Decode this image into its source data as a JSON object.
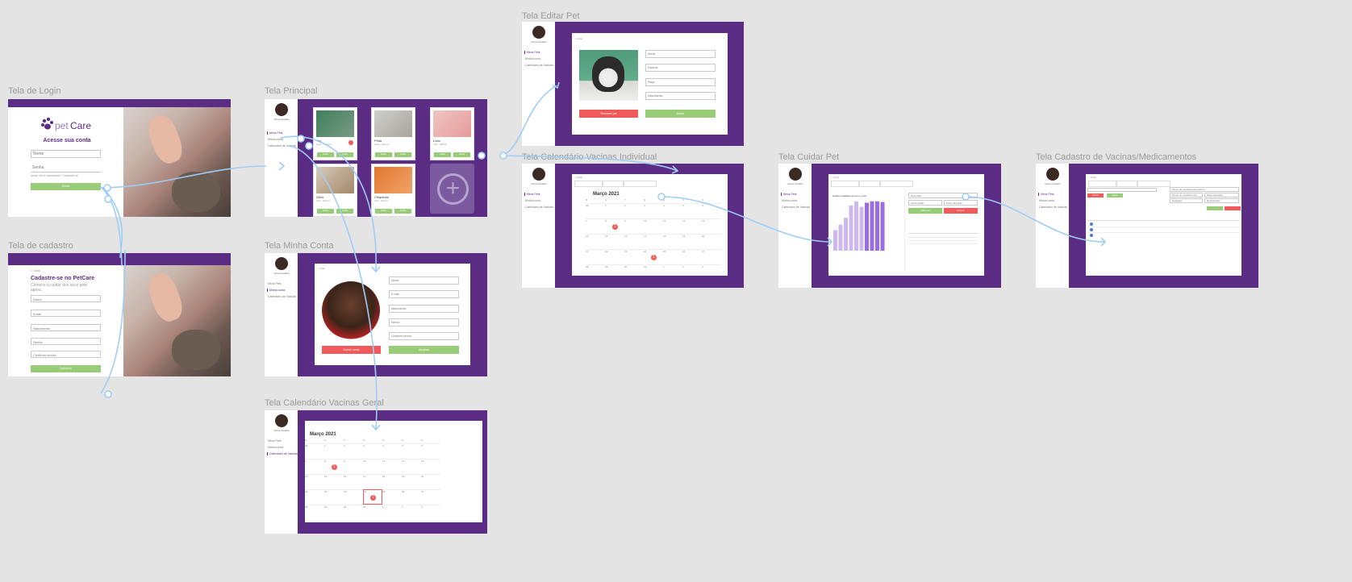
{
  "frames": {
    "login": {
      "title": "Tela de Login",
      "brand_pet": "pet",
      "brand_care": "Care",
      "heading": "Acesse sua conta",
      "name_placeholder": "Nome",
      "password_placeholder": "Senha",
      "forgot": "Ainda não é cadastrado? Cadastre-se",
      "login_button": "Entrar"
    },
    "signup": {
      "title": "Tela de cadastro",
      "back": "< Voltar",
      "heading": "Cadastre-se no PetCare",
      "sub": "Comece a cuidar dos seus pets agora.",
      "fields": [
        "Nome",
        "Email",
        "Nascimento",
        "Senha",
        "Confirme senha"
      ],
      "submit": "Cadastrar"
    },
    "main": {
      "title": "Tela Principal",
      "pets": [
        {
          "name": "Tey",
          "sub": "Gato · Fêmea",
          "btn1": "Editar",
          "btn2": "Cuidar"
        },
        {
          "name": "Phila",
          "sub": "Gato · Fêmea",
          "btn1": "Editar",
          "btn2": "Cuidar"
        },
        {
          "name": "Lobo",
          "sub": "Cão · Macho",
          "btn1": "Editar",
          "btn2": "Cuidar"
        },
        {
          "name": "Olivo",
          "sub": "Cão · Macho",
          "btn1": "Editar",
          "btn2": "Cuidar"
        },
        {
          "name": "Chiquinho",
          "sub": "Cão · Macho",
          "btn1": "Editar",
          "btn2": "Cuidar"
        }
      ],
      "add_symbol": "+"
    },
    "account": {
      "title": "Tela Minha Conta",
      "back": "< Voltar",
      "fields": [
        "Nome",
        "E-mail",
        "Nascimento",
        "Senha",
        "Confirme senha"
      ],
      "delete": "Excluir conta",
      "update": "Atualizar"
    },
    "calgeneral": {
      "title": "Tela Calendário Vacinas Geral",
      "month": "Março 2021"
    },
    "editpet": {
      "title": "Tela Editar Pet",
      "back": "< Voltar",
      "fields": [
        "Nome",
        "Espécie",
        "Raça",
        "Nascimento"
      ],
      "remove": "Remover pet",
      "save": "Salvar"
    },
    "calind": {
      "title": "Tela Calendário Vacinas Individual",
      "month": "Março 2021",
      "back": "< Voltar"
    },
    "care": {
      "title": "Tela Cuidar Pet",
      "back": "< Voltar",
      "chart_title": "Gráfico cuidados do pet no mês",
      "f1": "Descrição",
      "f2": "Observação",
      "f3": "Data aplicação",
      "add": "Adicionar",
      "remove": "Excluir"
    },
    "vaccines": {
      "title": "Tela Cadastro de Vacinas/Medicamentos",
      "back": "< Voltar",
      "f1": "Nome do medicamento/vacina",
      "f2": "Nome do medicamento",
      "f3": "Dosagem",
      "f4": "Data aplicação",
      "f5": "Reaplicação",
      "b_red": "Excluir",
      "b_green": "Salvar"
    }
  },
  "sidebar": {
    "user": "Nome Usuário",
    "items": [
      "Meus Pets",
      "Minha conta",
      "Calendário de Vacinas"
    ]
  },
  "calendar": {
    "weekdays": [
      "D",
      "S",
      "T",
      "Q",
      "Q",
      "S",
      "S"
    ],
    "rows": [
      [
        "28",
        "1",
        "2",
        "3",
        "4",
        "5",
        "6"
      ],
      [
        "7",
        "8",
        "9",
        "10",
        "11",
        "12",
        "13"
      ],
      [
        "14",
        "15",
        "16",
        "17",
        "18",
        "19",
        "20"
      ],
      [
        "21",
        "22",
        "23",
        "24",
        "25",
        "26",
        "27"
      ],
      [
        "28",
        "29",
        "30",
        "31",
        "1",
        "2",
        "3"
      ]
    ],
    "badge": "1"
  },
  "colors": {
    "purple": "#5b2c83",
    "green": "#99cc77",
    "red": "#f15a5a",
    "link": "#9fcdf7"
  }
}
